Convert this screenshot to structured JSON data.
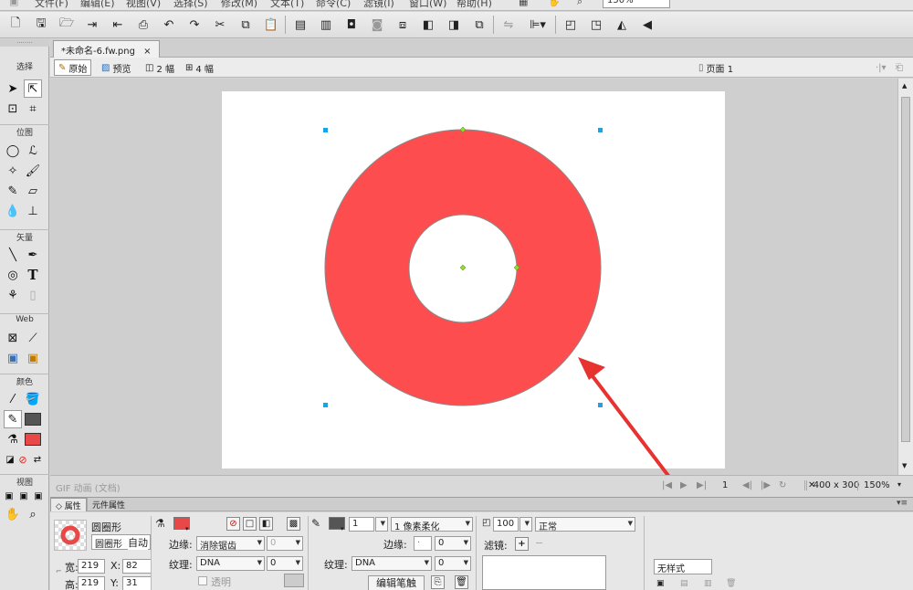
{
  "menu": {
    "items": [
      "文件(F)",
      "编辑(E)",
      "视图(V)",
      "选择(S)",
      "修改(M)",
      "文本(T)",
      "命令(C)",
      "滤镜(I)",
      "窗口(W)",
      "帮助(H)"
    ],
    "zoom": "150%"
  },
  "tools_panel": {
    "sections": {
      "select": "选择",
      "bitmap": "位图",
      "vector": "矢量",
      "web": "Web",
      "colors": "颜色",
      "view": "视图"
    },
    "text_tool": "T",
    "colors": {
      "stroke": "#555555",
      "fill": "#e84848"
    }
  },
  "document": {
    "tab_title": "*未命名-6.fw.png",
    "tab_close": "×",
    "view_buttons": {
      "original": "原始",
      "preview": "预览",
      "two_up": "2 幅",
      "four_up": "4 幅"
    },
    "page": "页面 1",
    "ring_color": "#fe4d4e",
    "annotation_color": "#e8322f"
  },
  "status": {
    "animation": "GIF 动画 (文档)",
    "frame": "1",
    "size": "400 x 300",
    "zoom": "150%"
  },
  "properties": {
    "tabs": {
      "properties": "属性",
      "symbol": "元件属性"
    },
    "object_type": "圆圈形",
    "object_name": "圆圈形",
    "auto_label": "自动",
    "width_label": "宽:",
    "width": "219",
    "height_label": "高:",
    "height": "219",
    "x_label": "X:",
    "x": "82",
    "y_label": "Y:",
    "y": "31",
    "fill": {
      "edge_label": "边缘:",
      "edge_value": "消除锯齿",
      "edge_amount": "0",
      "texture_label": "纹理:",
      "texture_value": "DNA",
      "texture_amount": "0",
      "transparent_label": "透明"
    },
    "stroke": {
      "size": "1",
      "type": "1 像素柔化",
      "edge_label": "边缘:",
      "edge_value": "0",
      "texture_label": "纹理:",
      "texture_value": "DNA",
      "texture_amount": "0",
      "edit_button": "编辑笔触"
    },
    "opacity": "100",
    "blend_mode": "正常",
    "filters_label": "滤镜:",
    "style": "无样式"
  }
}
